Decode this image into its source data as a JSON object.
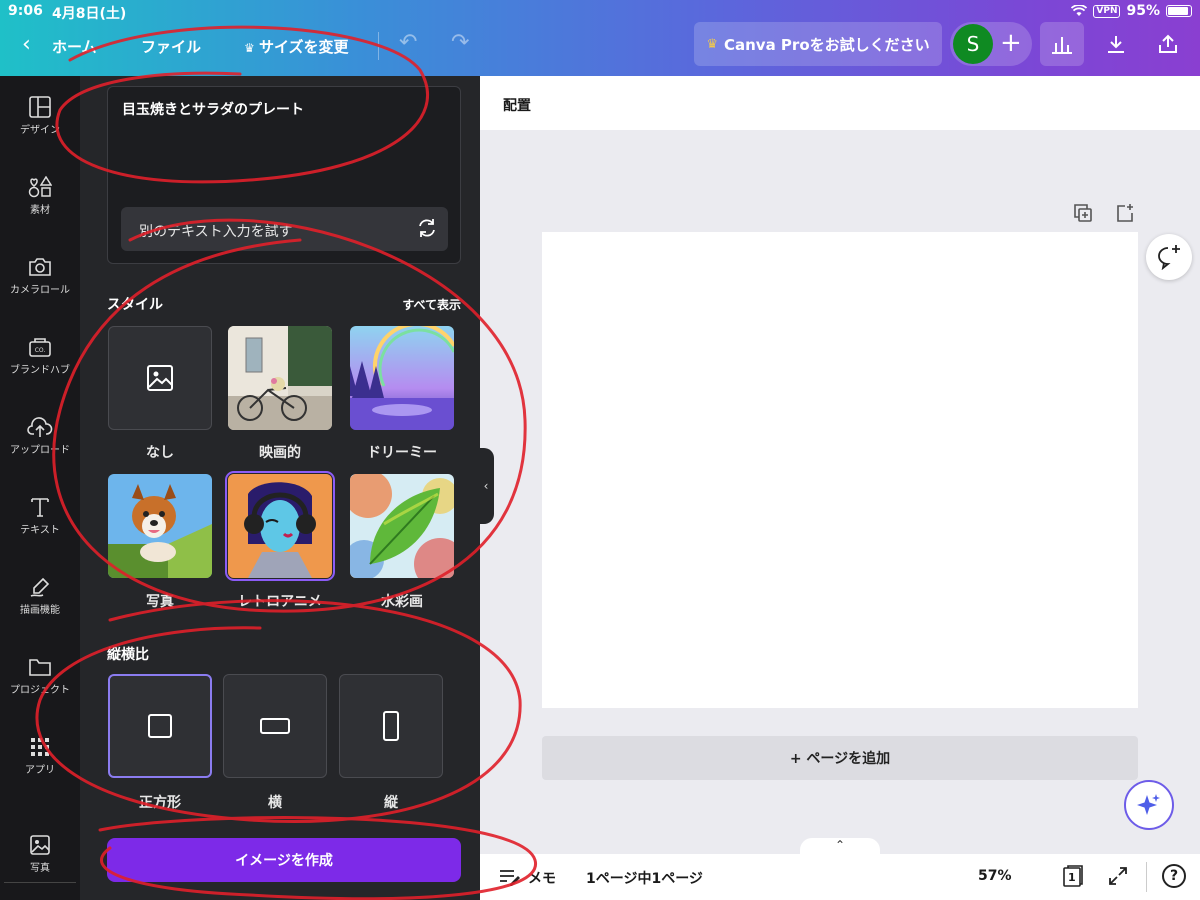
{
  "status": {
    "time": "9:06",
    "date": "4月8日(土)",
    "vpn": "VPN",
    "battery": "95%"
  },
  "toolbar": {
    "home": "ホーム",
    "file": "ファイル",
    "resize": "サイズを変更",
    "pro": "Canva Proをお試しください",
    "avatar_initial": "S"
  },
  "rail": {
    "items": [
      {
        "label": "デザイン",
        "icon": "design-layout-icon"
      },
      {
        "label": "素材",
        "icon": "elements-shapes-icon"
      },
      {
        "label": "カメラロール",
        "icon": "camera-icon"
      },
      {
        "label": "ブランドハブ",
        "icon": "brand-hub-icon"
      },
      {
        "label": "アップロード",
        "icon": "upload-cloud-icon"
      },
      {
        "label": "テキスト",
        "icon": "text-icon"
      },
      {
        "label": "描画機能",
        "icon": "draw-pen-icon"
      },
      {
        "label": "プロジェクト",
        "icon": "folder-icon"
      },
      {
        "label": "アプリ",
        "icon": "apps-grid-icon"
      },
      {
        "label": "写真",
        "icon": "photo-icon"
      }
    ]
  },
  "panel": {
    "prompt": "目玉焼きとサラダのプレート",
    "retry_label": "別のテキスト入力を試す",
    "style_title": "スタイル",
    "see_all": "すべて表示",
    "styles": [
      {
        "label": "なし"
      },
      {
        "label": "映画的"
      },
      {
        "label": "ドリーミー"
      },
      {
        "label": "写真"
      },
      {
        "label": "レトロアニメ"
      },
      {
        "label": "水彩画"
      }
    ],
    "selected_style": "レトロアニメ",
    "ratio_title": "縦横比",
    "ratios": [
      {
        "label": "正方形"
      },
      {
        "label": "横"
      },
      {
        "label": "縦"
      }
    ],
    "selected_ratio": "正方形",
    "create_button": "イメージを作成"
  },
  "canvas": {
    "arrange": "配置",
    "add_page": "+ ページを追加"
  },
  "bottom": {
    "memo": "メモ",
    "page_info": "1ページ中1ページ",
    "zoom": "57%",
    "page_count": "1",
    "help": "?"
  },
  "colors": {
    "accent": "#7d2ae8",
    "selection": "#8b5cf6",
    "annotation": "#e0202a"
  }
}
